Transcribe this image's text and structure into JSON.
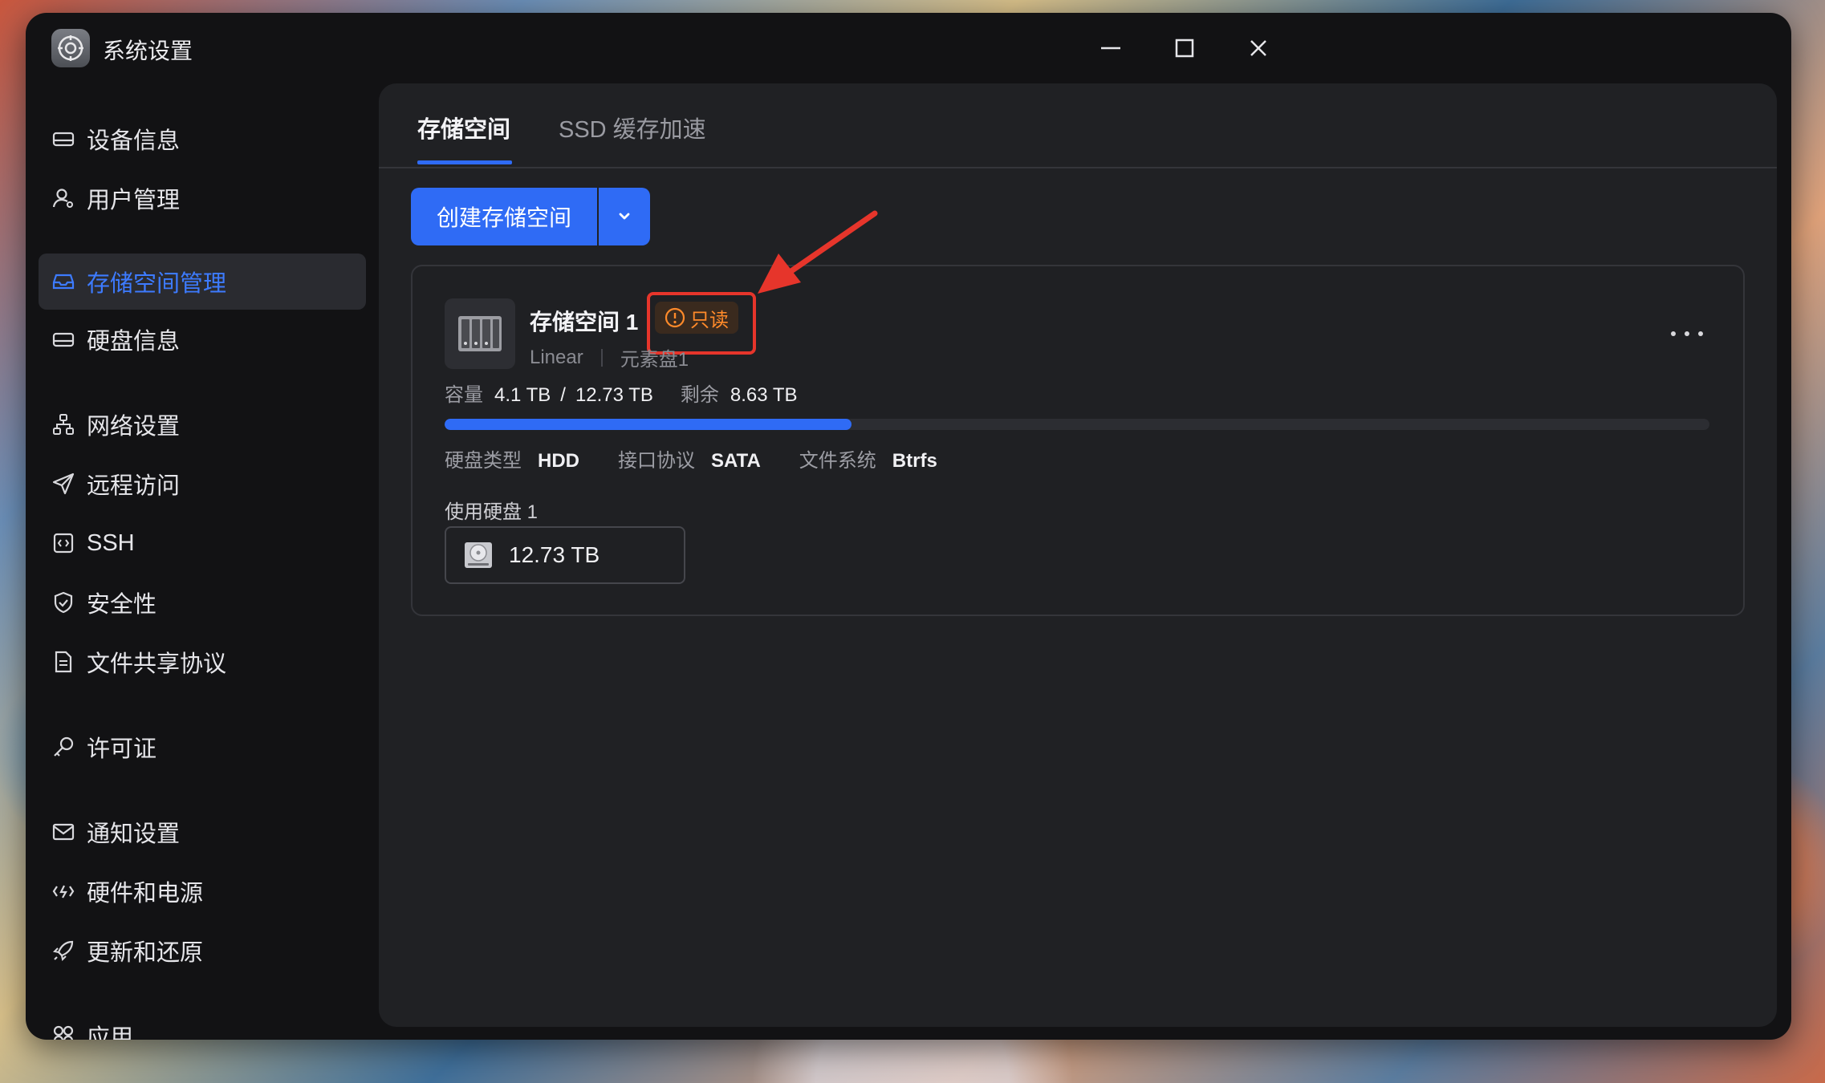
{
  "window": {
    "title": "系统设置"
  },
  "sidebar": {
    "items": [
      {
        "label": "设备信息",
        "icon": "device-icon"
      },
      {
        "label": "用户管理",
        "icon": "user-icon"
      },
      {
        "label": "存储空间管理",
        "icon": "storage-icon",
        "active": true
      },
      {
        "label": "硬盘信息",
        "icon": "disk-icon"
      },
      {
        "label": "网络设置",
        "icon": "network-icon"
      },
      {
        "label": "远程访问",
        "icon": "send-icon"
      },
      {
        "label": "SSH",
        "icon": "terminal-icon"
      },
      {
        "label": "安全性",
        "icon": "shield-icon"
      },
      {
        "label": "文件共享协议",
        "icon": "file-icon"
      },
      {
        "label": "许可证",
        "icon": "key-icon"
      },
      {
        "label": "通知设置",
        "icon": "mail-icon"
      },
      {
        "label": "硬件和电源",
        "icon": "power-icon"
      },
      {
        "label": "更新和还原",
        "icon": "rocket-icon"
      },
      {
        "label": "应用",
        "icon": "apps-icon"
      }
    ]
  },
  "tabs": [
    {
      "label": "存储空间",
      "active": true
    },
    {
      "label": "SSD 缓存加速",
      "active": false
    }
  ],
  "create_button": {
    "label": "创建存储空间"
  },
  "storage_card": {
    "name": "存储空间 1",
    "badge": "只读",
    "raid": "Linear",
    "disk_name": "元素盘1",
    "capacity_label": "容量",
    "used": "4.1 TB",
    "slash": "/",
    "total": "12.73 TB",
    "remaining_label": "剩余",
    "remaining": "8.63 TB",
    "usage_fraction": 0.322,
    "disk_type_label": "硬盘类型",
    "disk_type": "HDD",
    "interface_label": "接口协议",
    "interface": "SATA",
    "fs_label": "文件系统",
    "fs": "Btrfs",
    "used_disks_label": "使用硬盘 1",
    "disk_size": "12.73 TB"
  },
  "colors": {
    "accent": "#2f6bf5",
    "badge_text": "#ff8a2a",
    "highlight": "#e6352b"
  }
}
